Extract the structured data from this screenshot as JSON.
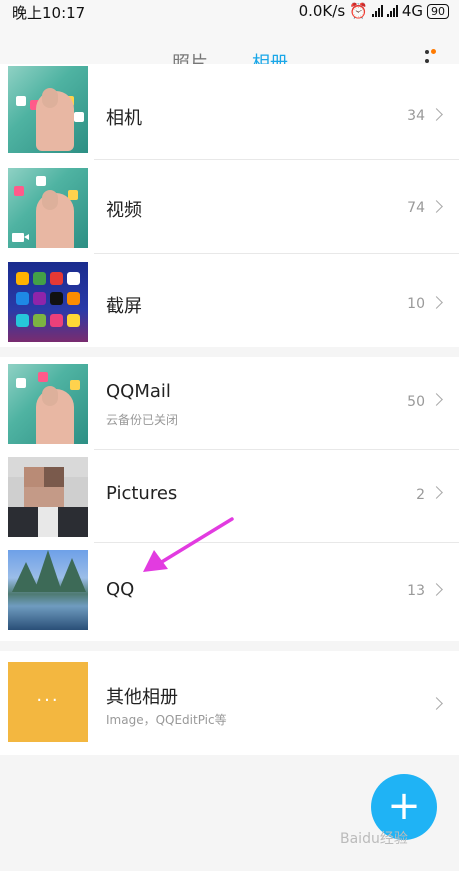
{
  "status_bar": {
    "time": "晚上10:17",
    "network_speed": "0.0K/s",
    "network_type": "4G",
    "battery": "90"
  },
  "tabs": [
    {
      "label": "照片",
      "active": false
    },
    {
      "label": "相册",
      "active": true
    }
  ],
  "albums": [
    {
      "name": "相机",
      "count": "34"
    },
    {
      "name": "视频",
      "count": "74"
    },
    {
      "name": "截屏",
      "count": "10"
    },
    {
      "name": "QQMail",
      "subtitle": "云备份已关闭",
      "count": "50"
    },
    {
      "name": "Pictures",
      "count": "2"
    },
    {
      "name": "QQ",
      "count": "13"
    }
  ],
  "other_albums": {
    "name": "其他相册",
    "subtitle": "Image，QQEditPic等",
    "folder_label": "···"
  },
  "fab": {
    "label": "+"
  },
  "watermark": "Baidu经验",
  "colors": {
    "accent": "#1aa7e8",
    "fab": "#1fb3f5",
    "folder": "#f3b740",
    "annotation_arrow": "#e23be0",
    "notification_dot": "#ff7a00"
  }
}
